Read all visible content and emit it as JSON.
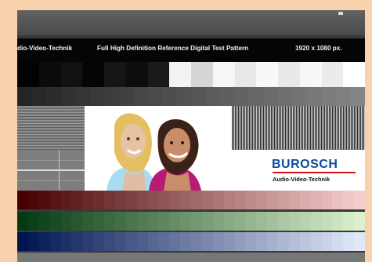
{
  "pattern": {
    "header_left": "dio-Video-Technik",
    "header_title": "Full High Definition Reference Digital Test Pattern",
    "resolution": "1920 x 1080 px."
  },
  "logo": {
    "brand": "BUROSCH",
    "subtitle": "Audio-Video-Technik"
  },
  "colors": {
    "frame_background": "#f7d2ad",
    "title_bar": "#050505",
    "brand_blue": "#0d4aa0",
    "brand_red": "#d1141a"
  }
}
